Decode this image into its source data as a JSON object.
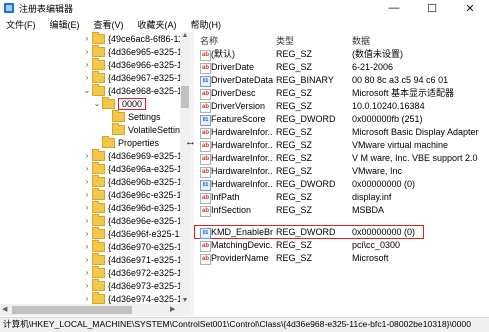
{
  "window": {
    "title": "注册表编辑器",
    "minimize": "—",
    "maximize": "☐",
    "close": "✕"
  },
  "menu": [
    "文件(F)",
    "编辑(E)",
    "查看(V)",
    "收藏夹(A)",
    "帮助(H)"
  ],
  "tree": {
    "top_partial": "{49ce6ac8-6f86-11c",
    "keys_above": [
      "{4d36e965-e325-11",
      "{4d36e966-e325-11",
      "{4d36e967-e325-11",
      "{4d36e968-e325-11"
    ],
    "selected_subkey": "0000",
    "subkey_children": [
      "Settings",
      "VolatileSettin"
    ],
    "properties": "Properties",
    "keys_below": [
      "{4d36e969-e325-11",
      "{4d36e96a-e325-11",
      "{4d36e96b-e325-11",
      "{4d36e96c-e325-11",
      "{4d36e96d-e325-11",
      "{4d36e96e-e325-11",
      "{4d36e96f-e325-11c",
      "{4d36e970-e325-11",
      "{4d36e971-e325-11",
      "{4d36e972-e325-11",
      "{4d36e973-e325-11",
      "{4d36e974-e325-11",
      "{4d36e975-e325-11"
    ]
  },
  "columns": {
    "name": "名称",
    "type": "类型",
    "data": "数据"
  },
  "values": [
    {
      "icon": "ab",
      "name": "(默认)",
      "type": "REG_SZ",
      "data": "(数值未设置)"
    },
    {
      "icon": "ab",
      "name": "DriverDate",
      "type": "REG_SZ",
      "data": "6-21-2006"
    },
    {
      "icon": "bin",
      "name": "DriverDateData",
      "type": "REG_BINARY",
      "data": "00 80 8c a3 c5 94 c6 01"
    },
    {
      "icon": "ab",
      "name": "DriverDesc",
      "type": "REG_SZ",
      "data": "Microsoft 基本显示适配器"
    },
    {
      "icon": "ab",
      "name": "DriverVersion",
      "type": "REG_SZ",
      "data": "10.0.10240.16384"
    },
    {
      "icon": "bin",
      "name": "FeatureScore",
      "type": "REG_DWORD",
      "data": "0x000000fb (251)"
    },
    {
      "icon": "ab",
      "name": "HardwareInfor...",
      "type": "REG_SZ",
      "data": "Microsoft Basic Display Adapter"
    },
    {
      "icon": "ab",
      "name": "HardwareInfor...",
      "type": "REG_SZ",
      "data": "VMware virtual machine"
    },
    {
      "icon": "ab",
      "name": "HardwareInfor...",
      "type": "REG_SZ",
      "data": "V M ware, Inc. VBE support 2.0"
    },
    {
      "icon": "ab",
      "name": "HardwareInfor...",
      "type": "REG_SZ",
      "data": "VMware, Inc"
    },
    {
      "icon": "bin",
      "name": "HardwareInfor...",
      "type": "REG_DWORD",
      "data": "0x00000000 (0)"
    },
    {
      "icon": "ab",
      "name": "InfPath",
      "type": "REG_SZ",
      "data": "display.inf"
    },
    {
      "icon": "ab",
      "name": "InfSection",
      "type": "REG_SZ",
      "data": "MSBDA"
    },
    {
      "icon": "bin",
      "name": "KMD_EnableBr...",
      "type": "REG_DWORD",
      "data": "0x00000000 (0)"
    },
    {
      "icon": "ab",
      "name": "MatchingDevic...",
      "type": "REG_SZ",
      "data": "pci\\cc_0300"
    },
    {
      "icon": "ab",
      "name": "ProviderName",
      "type": "REG_SZ",
      "data": "Microsoft"
    }
  ],
  "status": "计算机\\HKEY_LOCAL_MACHINE\\SYSTEM\\ControlSet001\\Control\\Class\\{4d36e968-e325-11ce-bfc1-08002be10318}\\0000"
}
